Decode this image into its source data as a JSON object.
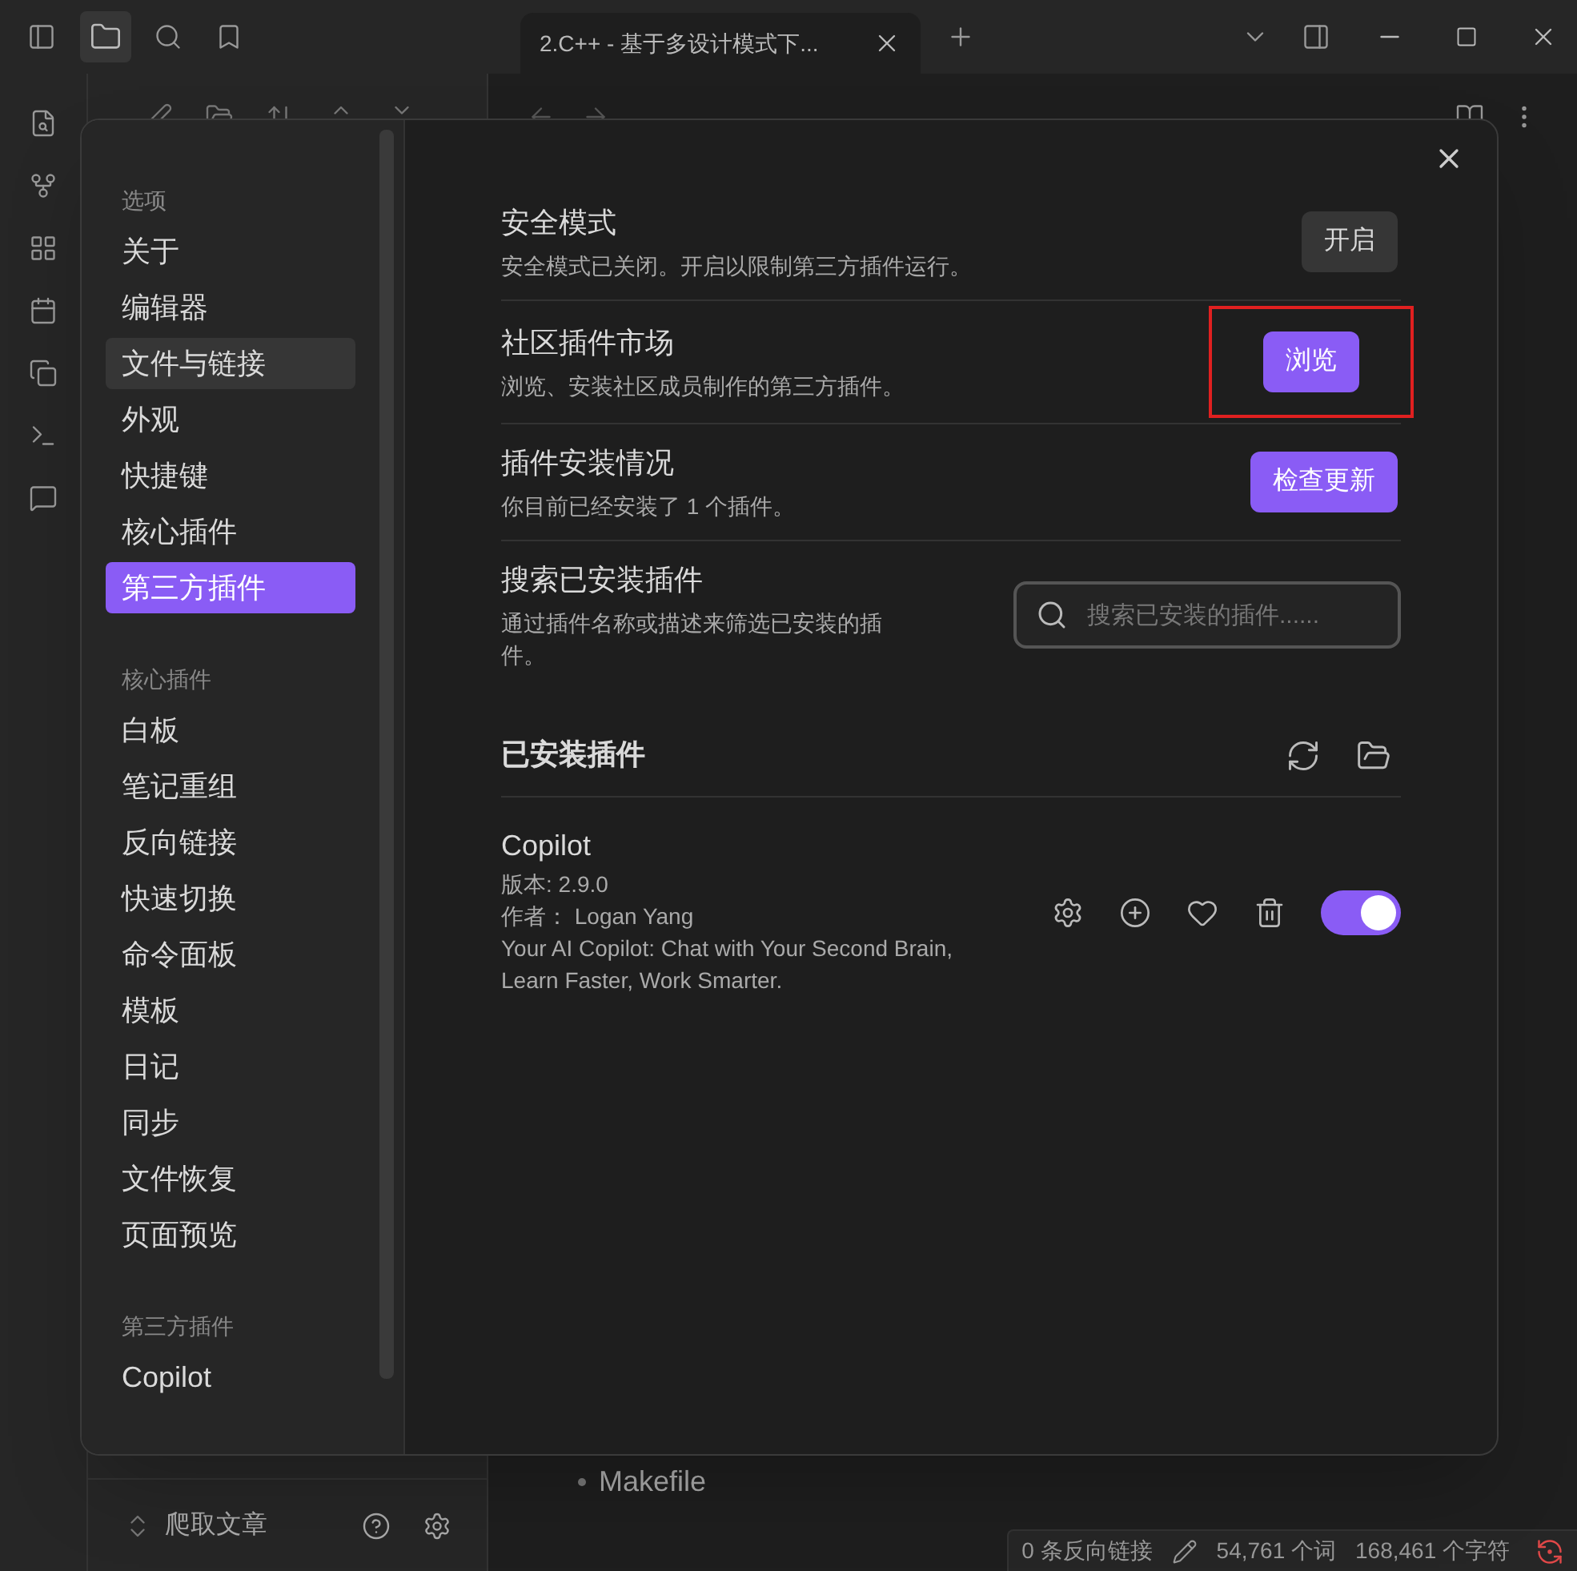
{
  "tab": {
    "title": "2.C++ - 基于多设计模式下...",
    "selected": true
  },
  "editor": {
    "bullet_item": "Makefile"
  },
  "vault_footer": {
    "name": "爬取文章"
  },
  "status_bar": {
    "backlinks": "0 条反向链接",
    "words": "54,761 个词",
    "chars": "168,461 个字符"
  },
  "settings": {
    "sidebar": [
      {
        "heading": "选项",
        "items": [
          {
            "label": "关于",
            "selected": false,
            "hovered": false
          },
          {
            "label": "编辑器",
            "selected": false,
            "hovered": false
          },
          {
            "label": "文件与链接",
            "selected": false,
            "hovered": true
          },
          {
            "label": "外观",
            "selected": false,
            "hovered": false
          },
          {
            "label": "快捷键",
            "selected": false,
            "hovered": false
          },
          {
            "label": "核心插件",
            "selected": false,
            "hovered": false
          },
          {
            "label": "第三方插件",
            "selected": true,
            "hovered": false
          }
        ]
      },
      {
        "heading": "核心插件",
        "items": [
          {
            "label": "白板",
            "selected": false,
            "hovered": false
          },
          {
            "label": "笔记重组",
            "selected": false,
            "hovered": false
          },
          {
            "label": "反向链接",
            "selected": false,
            "hovered": false
          },
          {
            "label": "快速切换",
            "selected": false,
            "hovered": false
          },
          {
            "label": "命令面板",
            "selected": false,
            "hovered": false
          },
          {
            "label": "模板",
            "selected": false,
            "hovered": false
          },
          {
            "label": "日记",
            "selected": false,
            "hovered": false
          },
          {
            "label": "同步",
            "selected": false,
            "hovered": false
          },
          {
            "label": "文件恢复",
            "selected": false,
            "hovered": false
          },
          {
            "label": "页面预览",
            "selected": false,
            "hovered": false
          }
        ]
      },
      {
        "heading": "第三方插件",
        "items": [
          {
            "label": "Copilot",
            "selected": false,
            "hovered": false
          }
        ]
      }
    ],
    "rows": [
      {
        "kind": "button",
        "name": "安全模式",
        "description": "安全模式已关闭。开启以限制第三方插件运行。",
        "button": "开启",
        "accent": false,
        "highlighted": false
      },
      {
        "kind": "button",
        "name": "社区插件市场",
        "description": "浏览、安装社区成员制作的第三方插件。",
        "button": "浏览",
        "accent": true,
        "highlighted": true
      },
      {
        "kind": "button",
        "name": "插件安装情况",
        "description": "你目前已经安装了 1 个插件。",
        "button": "检查更新",
        "accent": true,
        "highlighted": false
      },
      {
        "kind": "search",
        "name": "搜索已安装插件",
        "description": "通过插件名称或描述来筛选已安装的插件。",
        "placeholder": "搜索已安装的插件......"
      }
    ],
    "installed_heading": "已安装插件",
    "plugins": [
      {
        "name": "Copilot",
        "version": "版本: 2.9.0",
        "author": "作者： Logan Yang",
        "description": "Your AI Copilot: Chat with Your Second Brain, Learn Faster, Work Smarter.",
        "on": true
      }
    ]
  }
}
